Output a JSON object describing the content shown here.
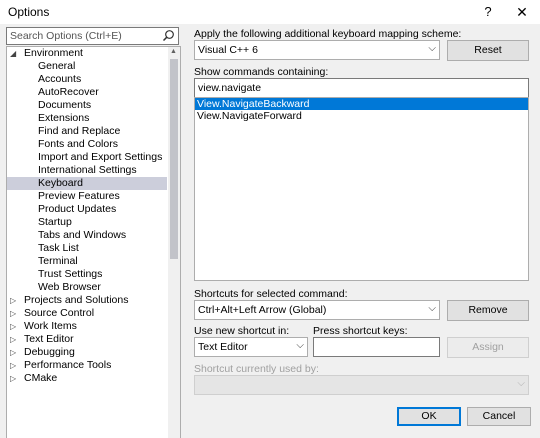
{
  "window": {
    "title": "Options",
    "help_glyph": "?",
    "close_glyph": "✕"
  },
  "search": {
    "placeholder": "Search Options (Ctrl+E)"
  },
  "tree": {
    "items": [
      {
        "label": "Environment",
        "level": 0,
        "expanded": true
      },
      {
        "label": "General",
        "level": 1
      },
      {
        "label": "Accounts",
        "level": 1
      },
      {
        "label": "AutoRecover",
        "level": 1
      },
      {
        "label": "Documents",
        "level": 1
      },
      {
        "label": "Extensions",
        "level": 1
      },
      {
        "label": "Find and Replace",
        "level": 1
      },
      {
        "label": "Fonts and Colors",
        "level": 1
      },
      {
        "label": "Import and Export Settings",
        "level": 1
      },
      {
        "label": "International Settings",
        "level": 1
      },
      {
        "label": "Keyboard",
        "level": 1,
        "selected": true
      },
      {
        "label": "Preview Features",
        "level": 1
      },
      {
        "label": "Product Updates",
        "level": 1
      },
      {
        "label": "Startup",
        "level": 1
      },
      {
        "label": "Tabs and Windows",
        "level": 1
      },
      {
        "label": "Task List",
        "level": 1
      },
      {
        "label": "Terminal",
        "level": 1
      },
      {
        "label": "Trust Settings",
        "level": 1
      },
      {
        "label": "Web Browser",
        "level": 1
      },
      {
        "label": "Projects and Solutions",
        "level": 0,
        "expanded": false
      },
      {
        "label": "Source Control",
        "level": 0,
        "expanded": false
      },
      {
        "label": "Work Items",
        "level": 0,
        "expanded": false
      },
      {
        "label": "Text Editor",
        "level": 0,
        "expanded": false
      },
      {
        "label": "Debugging",
        "level": 0,
        "expanded": false
      },
      {
        "label": "Performance Tools",
        "level": 0,
        "expanded": false
      },
      {
        "label": "CMake",
        "level": 0,
        "expanded": false
      }
    ]
  },
  "keyboard": {
    "scheme_label": "Apply the following additional keyboard mapping scheme:",
    "scheme_value": "Visual C++ 6",
    "reset_label": "Reset",
    "show_commands_label": "Show commands containing:",
    "show_commands_value": "view.navigate",
    "commands": [
      {
        "label": "View.NavigateBackward",
        "selected": true
      },
      {
        "label": "View.NavigateForward",
        "selected": false
      }
    ],
    "shortcuts_label": "Shortcuts for selected command:",
    "shortcut_value": "Ctrl+Alt+Left Arrow (Global)",
    "remove_label": "Remove",
    "use_shortcut_label": "Use new shortcut in:",
    "use_shortcut_value": "Text Editor",
    "press_keys_label": "Press shortcut keys:",
    "press_keys_value": "",
    "assign_label": "Assign",
    "currently_used_label": "Shortcut currently used by:",
    "currently_used_value": ""
  },
  "footer": {
    "ok_label": "OK",
    "cancel_label": "Cancel"
  },
  "colors": {
    "selection_blue": "#0078d7",
    "tree_selection": "#cccedb"
  }
}
